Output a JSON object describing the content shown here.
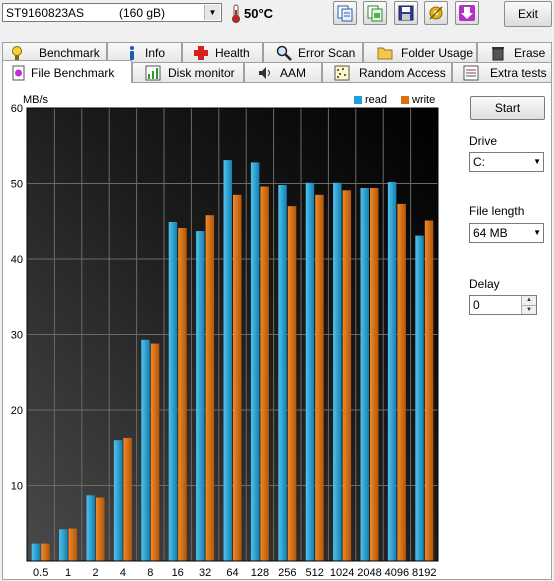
{
  "toolbar": {
    "drive_name": "ST9160823AS",
    "drive_size": "(160 gB)",
    "temperature": "50°C",
    "exit_label": "Exit"
  },
  "tabs_row1": [
    {
      "label": "Benchmark",
      "icon": "benchmark-icon"
    },
    {
      "label": "Info",
      "icon": "info-icon"
    },
    {
      "label": "Health",
      "icon": "health-cross-icon"
    },
    {
      "label": "Error Scan",
      "icon": "magnifier-icon"
    },
    {
      "label": "Folder Usage",
      "icon": "folder-icon"
    },
    {
      "label": "Erase",
      "icon": "trash-icon"
    }
  ],
  "tabs_row2": [
    {
      "label": "File Benchmark",
      "icon": "file-benchmark-icon",
      "active": true
    },
    {
      "label": "Disk monitor",
      "icon": "chart-icon"
    },
    {
      "label": "AAM",
      "icon": "speaker-icon"
    },
    {
      "label": "Random Access",
      "icon": "random-access-icon"
    },
    {
      "label": "Extra tests",
      "icon": "extra-tests-icon"
    }
  ],
  "side": {
    "start_label": "Start",
    "drive_label": "Drive",
    "drive_value": "C:",
    "file_length_label": "File length",
    "file_length_value": "64 MB",
    "delay_label": "Delay",
    "delay_value": "0"
  },
  "chart_data": {
    "type": "bar",
    "ylabel": "MB/s",
    "ylim": [
      0,
      60
    ],
    "yticks": [
      10,
      20,
      30,
      40,
      50,
      60
    ],
    "categories": [
      "0.5",
      "1",
      "2",
      "4",
      "8",
      "16",
      "32",
      "64",
      "128",
      "256",
      "512",
      "1024",
      "2048",
      "4096",
      "8192"
    ],
    "series": [
      {
        "name": "read",
        "color": "#1e9fd6",
        "values": [
          2.3,
          4.2,
          8.7,
          16.0,
          29.3,
          44.9,
          43.7,
          53.1,
          52.8,
          49.8,
          50.1,
          50.1,
          49.4,
          50.2,
          43.1
        ]
      },
      {
        "name": "write",
        "color": "#d9700f",
        "values": [
          2.3,
          4.3,
          8.4,
          16.3,
          28.8,
          44.1,
          45.8,
          48.5,
          49.6,
          47.0,
          48.5,
          49.1,
          49.4,
          47.3,
          45.1
        ]
      }
    ],
    "grid": true,
    "legend": "top-right"
  }
}
